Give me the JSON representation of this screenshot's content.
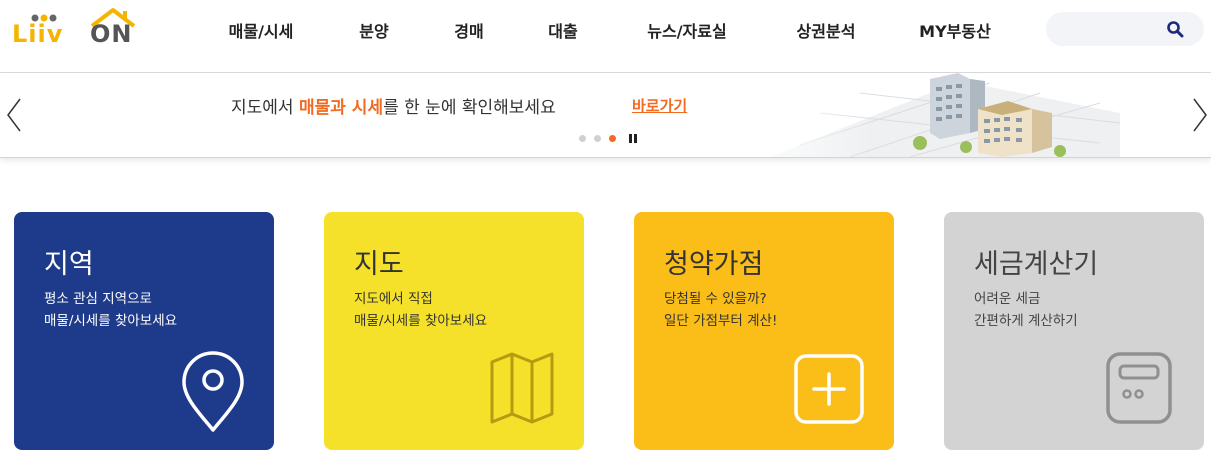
{
  "header": {
    "logo": {
      "text_left": "Liiv",
      "text_right": "ON"
    },
    "nav": [
      {
        "label": "매물/시세"
      },
      {
        "label": "분양"
      },
      {
        "label": "경매"
      },
      {
        "label": "대출"
      },
      {
        "label": "뉴스/자료실"
      },
      {
        "label": "상권분석"
      },
      {
        "label": "MY부동산"
      }
    ],
    "search": {
      "placeholder": "",
      "icon": "search-icon"
    }
  },
  "banner": {
    "text_before": "지도에서 ",
    "text_highlight": "매물과 시세",
    "text_after": "를 한 눈에 확인해보세요",
    "link_label": "바로가기",
    "slide_count": 3,
    "active_slide": 3,
    "accent_color": "#f26b21"
  },
  "cards": [
    {
      "title": "지역",
      "desc": [
        "평소 관심 지역으로",
        "매물/시세를 찾아보세요"
      ],
      "icon": "location-pin-icon",
      "bg": "#1e3a8a",
      "text_color": "#ffffff"
    },
    {
      "title": "지도",
      "desc": [
        "지도에서 직접",
        "매물/시세를 찾아보세요"
      ],
      "icon": "map-icon",
      "bg": "#f5e12a",
      "text_color": "#333333"
    },
    {
      "title": "청약가점",
      "desc": [
        "당첨될 수 있을까?",
        "일단 가점부터 계산!"
      ],
      "icon": "plus-box-icon",
      "bg": "#fbbd18",
      "text_color": "#333333"
    },
    {
      "title": "세금계산기",
      "desc": [
        "어려운 세금",
        "간편하게 계산하기"
      ],
      "icon": "calculator-icon",
      "bg": "#d4d3d3",
      "text_color": "#444444"
    }
  ]
}
